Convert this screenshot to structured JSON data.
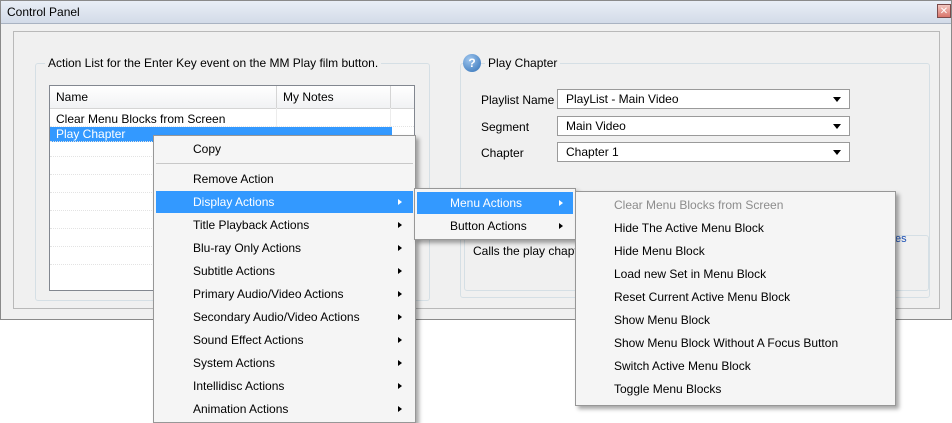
{
  "window": {
    "title": "Control Panel",
    "close_glyph": "✕"
  },
  "action_list": {
    "group_label": "Action List for the Enter Key event on the MM Play film button.",
    "columns": [
      "Name",
      "My Notes"
    ],
    "rows": [
      {
        "name": "Clear Menu Blocks from Screen",
        "notes": "",
        "selected": false
      },
      {
        "name": "Play Chapter",
        "notes": "",
        "selected": true
      }
    ]
  },
  "play_chapter": {
    "help_icon": "help-circle-icon",
    "help_glyph": "?",
    "group_label": "Play Chapter",
    "fields": [
      {
        "label": "Playlist Name",
        "value": "PlayList - Main Video"
      },
      {
        "label": "Segment",
        "value": "Main Video"
      },
      {
        "label": "Chapter",
        "value": "Chapter 1"
      }
    ],
    "description": "Calls the play chapter",
    "partial_link": "es"
  },
  "context_menu": {
    "items": [
      {
        "label": "Copy",
        "submenu": false
      },
      {
        "label": "Remove Action",
        "submenu": false
      },
      {
        "label": "Display Actions",
        "submenu": true,
        "highlighted": true
      },
      {
        "label": "Title Playback Actions",
        "submenu": true
      },
      {
        "label": "Blu-ray Only Actions",
        "submenu": true
      },
      {
        "label": "Subtitle Actions",
        "submenu": true
      },
      {
        "label": "Primary Audio/Video Actions",
        "submenu": true
      },
      {
        "label": "Secondary Audio/Video Actions",
        "submenu": true
      },
      {
        "label": "Sound Effect Actions",
        "submenu": true
      },
      {
        "label": "System Actions",
        "submenu": true
      },
      {
        "label": "Intellidisc Actions",
        "submenu": true
      },
      {
        "label": "Animation Actions",
        "submenu": true
      }
    ]
  },
  "display_submenu": {
    "items": [
      {
        "label": "Menu Actions",
        "submenu": true,
        "highlighted": true
      },
      {
        "label": "Button Actions",
        "submenu": true
      }
    ]
  },
  "menu_actions_submenu": {
    "items": [
      {
        "label": "Clear Menu Blocks from Screen",
        "disabled": true
      },
      {
        "label": "Hide The Active Menu Block"
      },
      {
        "label": "Hide Menu Block"
      },
      {
        "label": "Load new Set in Menu Block"
      },
      {
        "label": "Reset Current Active Menu Block"
      },
      {
        "label": "Show Menu Block"
      },
      {
        "label": "Show Menu Block Without A Focus Button"
      },
      {
        "label": "Switch Active Menu Block"
      },
      {
        "label": "Toggle Menu Blocks"
      }
    ]
  }
}
